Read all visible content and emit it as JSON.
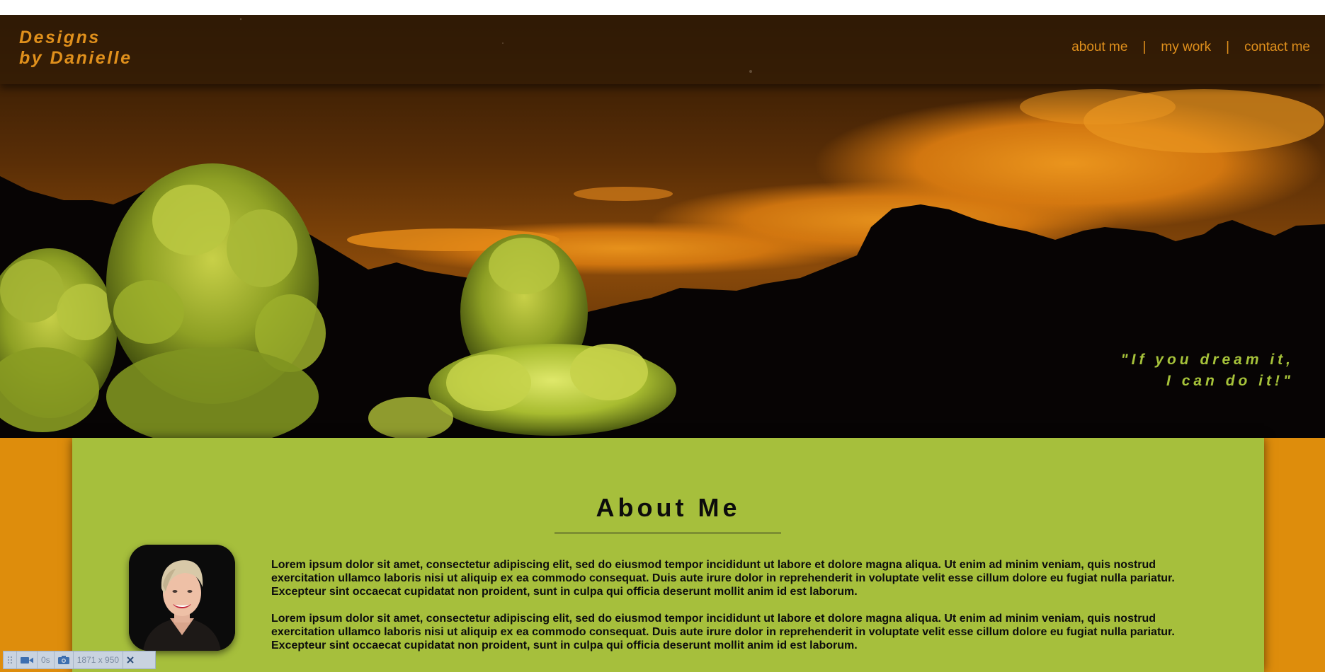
{
  "header": {
    "logo_line1": "Designs",
    "logo_line2": "by Danielle",
    "nav": [
      {
        "label": "about me"
      },
      {
        "label": "my work"
      },
      {
        "label": "contact me"
      }
    ],
    "separator": "|"
  },
  "hero": {
    "tagline_line1": "\"If you dream it,",
    "tagline_line2": "I can do it!\""
  },
  "about": {
    "title": "About Me",
    "paragraphs": [
      "Lorem ipsum dolor sit amet, consectetur adipiscing elit, sed do eiusmod tempor incididunt ut labore et dolore magna aliqua. Ut enim ad minim veniam, quis nostrud exercitation ullamco laboris nisi ut aliquip ex ea commodo consequat. Duis aute irure dolor in reprehenderit in voluptate velit esse cillum dolore eu fugiat nulla pariatur. Excepteur sint occaecat cupidatat non proident, sunt in culpa qui officia deserunt mollit anim id est laborum.",
      "Lorem ipsum dolor sit amet, consectetur adipiscing elit, sed do eiusmod tempor incididunt ut labore et dolore magna aliqua. Ut enim ad minim veniam, quis nostrud exercitation ullamco laboris nisi ut aliquip ex ea commodo consequat. Duis aute irure dolor in reprehenderit in voluptate velit esse cillum dolore eu fugiat nulla pariatur. Excepteur sint occaecat cupidatat non proident, sunt in culpa qui officia deserunt mollit anim id est laborum."
    ]
  },
  "devtools": {
    "timer": "0s",
    "dimensions": "1871 x 950",
    "icons": [
      "drag-handle-icon",
      "video-camera-icon",
      "camera-icon",
      "close-icon"
    ]
  },
  "colors": {
    "accent_orange": "#e0901c",
    "side_orange": "#de8d0c",
    "panel_green": "#a6bf3c",
    "tagline_green": "#a6c23a",
    "text_dark": "#0c0c0c"
  }
}
